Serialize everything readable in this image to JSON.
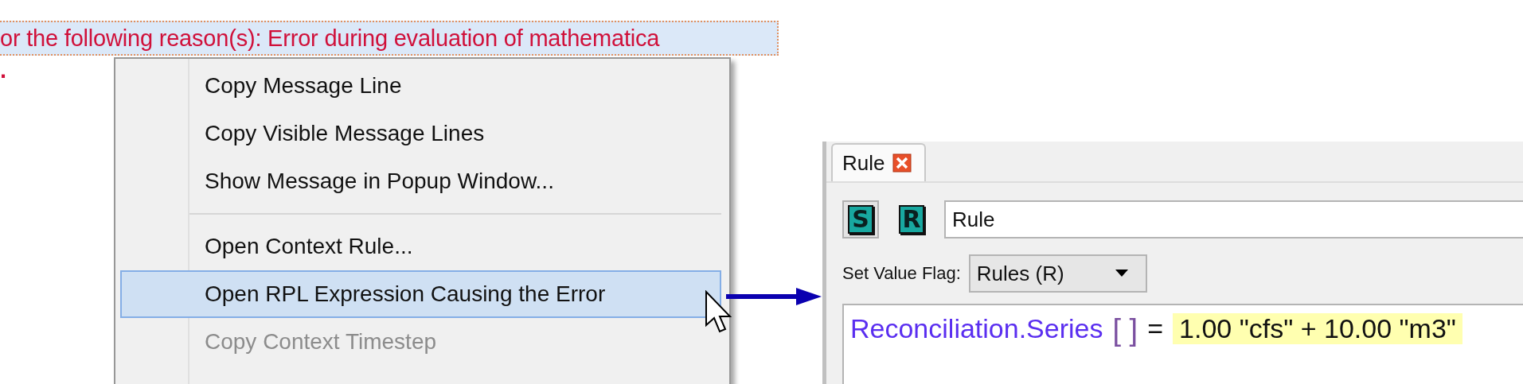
{
  "message": {
    "text": "or the following reason(s): Error during evaluation of mathematica",
    "continuation": "."
  },
  "context_menu": {
    "items": [
      {
        "kind": "item",
        "label": "Copy Message Line",
        "selected": false,
        "disabled": false
      },
      {
        "kind": "item",
        "label": "Copy Visible Message Lines",
        "selected": false,
        "disabled": false
      },
      {
        "kind": "item",
        "label": "Show Message in Popup Window...",
        "selected": false,
        "disabled": false
      },
      {
        "kind": "separator"
      },
      {
        "kind": "item",
        "label": "Open Context Rule...",
        "selected": false,
        "disabled": false
      },
      {
        "kind": "item",
        "label": "Open RPL Expression Causing the Error",
        "selected": true,
        "disabled": false
      },
      {
        "kind": "item",
        "label": "Copy Context Timestep",
        "selected": false,
        "disabled": true
      }
    ]
  },
  "rule_editor": {
    "tab": {
      "label": "Rule",
      "selected": true
    },
    "tool_buttons": [
      "S",
      "R"
    ],
    "name_field": {
      "value": "Rule"
    },
    "set_value_flag": {
      "label": "Set Value Flag:",
      "value": "Rules (R)"
    },
    "expression": {
      "slot": "Reconciliation.Series",
      "brackets": "[ ]",
      "operator": "=",
      "value": "1.00 \"cfs\" + 10.00 \"m3\""
    }
  }
}
